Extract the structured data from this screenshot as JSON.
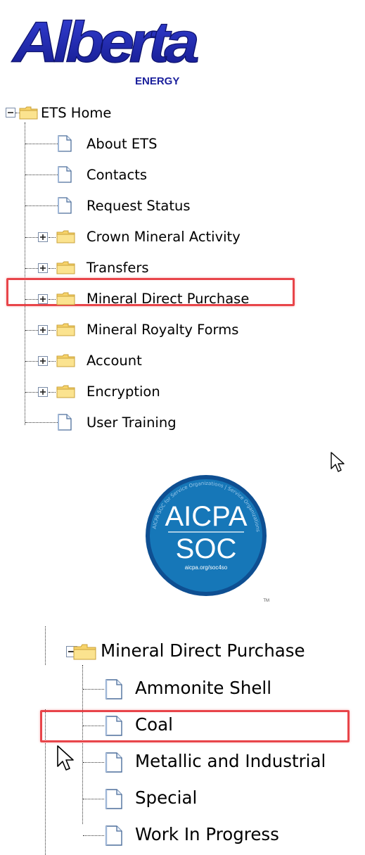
{
  "logo": {
    "wordmark": "Alberta",
    "subtitle": "ENERGY",
    "brand_color": "#1a1f9c",
    "accent_color": "#2a36c8"
  },
  "tree_top": {
    "root": {
      "label": "ETS Home",
      "expanded": true
    },
    "items": [
      {
        "label": "About ETS",
        "type": "page"
      },
      {
        "label": "Contacts",
        "type": "page"
      },
      {
        "label": "Request Status",
        "type": "page"
      },
      {
        "label": "Crown Mineral Activity",
        "type": "folder",
        "expanded": false
      },
      {
        "label": "Transfers",
        "type": "folder",
        "expanded": false
      },
      {
        "label": "Mineral Direct Purchase",
        "type": "folder",
        "expanded": false,
        "highlighted": true
      },
      {
        "label": "Mineral Royalty Forms",
        "type": "folder",
        "expanded": false
      },
      {
        "label": "Account",
        "type": "folder",
        "expanded": false
      },
      {
        "label": "Encryption",
        "type": "folder",
        "expanded": false
      },
      {
        "label": "User Training",
        "type": "page"
      }
    ]
  },
  "badge": {
    "line1": "AICPA",
    "line2": "SOC",
    "url": "aicpa.org/soc4so",
    "ring_text": "AICPA SOC for Service Organizations | Service Organizations",
    "tm": "TM",
    "color": "#1677b8",
    "ring_color": "#0e4f92"
  },
  "tree_bottom": {
    "root": {
      "label": "Mineral Direct Purchase",
      "expanded": true
    },
    "items": [
      {
        "label": "Ammonite Shell",
        "type": "page"
      },
      {
        "label": "Coal",
        "type": "page",
        "highlighted": true
      },
      {
        "label": "Metallic and Industrial",
        "type": "page"
      },
      {
        "label": "Special",
        "type": "page"
      },
      {
        "label": "Work In Progress",
        "type": "page"
      }
    ]
  },
  "colors": {
    "highlight": "#e8454a",
    "folder_fill": "#f7d36a",
    "folder_stroke": "#c9a23a",
    "doc_stroke": "#4d6f9c"
  }
}
